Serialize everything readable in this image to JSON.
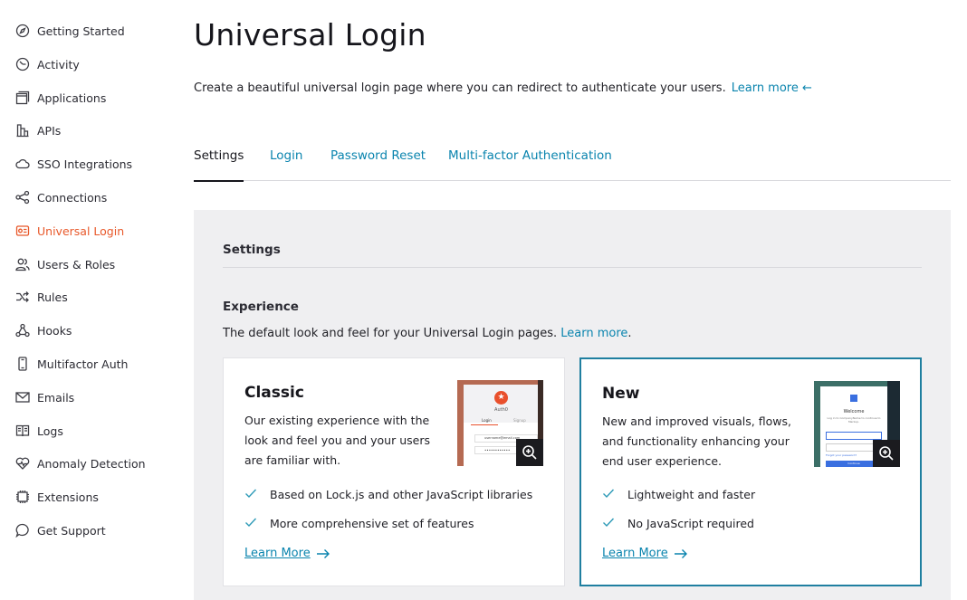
{
  "sidebar": {
    "items": [
      {
        "label": "Getting Started",
        "icon": "compass-icon"
      },
      {
        "label": "Activity",
        "icon": "activity-icon"
      },
      {
        "label": "Applications",
        "icon": "applications-icon"
      },
      {
        "label": "APIs",
        "icon": "apis-icon"
      },
      {
        "label": "SSO Integrations",
        "icon": "cloud-icon"
      },
      {
        "label": "Connections",
        "icon": "share-icon"
      },
      {
        "label": "Universal Login",
        "icon": "login-box-icon",
        "active": true
      },
      {
        "label": "Users & Roles",
        "icon": "users-icon"
      },
      {
        "label": "Rules",
        "icon": "rules-icon"
      },
      {
        "label": "Hooks",
        "icon": "hooks-icon"
      },
      {
        "label": "Multifactor Auth",
        "icon": "phone-icon"
      },
      {
        "label": "Emails",
        "icon": "mail-icon"
      },
      {
        "label": "Logs",
        "icon": "book-icon"
      },
      {
        "label": "Anomaly Detection",
        "icon": "heart-icon"
      },
      {
        "label": "Extensions",
        "icon": "chip-icon"
      },
      {
        "label": "Get Support",
        "icon": "chat-bubble-icon"
      }
    ]
  },
  "page": {
    "title": "Universal Login",
    "description": "Create a beautiful universal login page where you can redirect to authenticate your users.",
    "learn_more": "Learn more ←"
  },
  "tabs": [
    "Settings",
    "Login",
    "Password Reset",
    "Multi-factor Authentication"
  ],
  "settings": {
    "section_title": "Settings",
    "experience_title": "Experience",
    "experience_desc": "The default look and feel for your Universal Login pages.",
    "experience_link": "Learn more",
    "experience_link_suffix": "."
  },
  "cards": [
    {
      "title": "Classic",
      "description": "Our existing experience with the look and feel you and your users are familiar with.",
      "features": [
        "Based on Lock.js and other JavaScript libraries",
        "More comprehensive set of features"
      ],
      "learn_more": "Learn More",
      "selected": false,
      "thumb": {
        "brand": "Auth0",
        "tab_login": "Login",
        "tab_signup": "Signup",
        "field_email": "username@email.com",
        "field_password": "••••••••••••"
      }
    },
    {
      "title": "New",
      "description": "New and improved visuals, flows, and functionality enhancing your end user experience.",
      "features": [
        "Lightweight and faster",
        "No JavaScript required"
      ],
      "learn_more": "Learn More",
      "selected": true,
      "thumb": {
        "welcome": "Welcome",
        "subtitle": "Log in to CompanyName to continue to Markup.",
        "forgot": "Forgot your password?",
        "button": "Continue"
      }
    }
  ],
  "colors": {
    "accent": "#e8582a",
    "link": "#0a84ae",
    "selected_border": "#1f7fa0",
    "check": "#2d9ab7",
    "panel_bg": "#efeff1"
  }
}
